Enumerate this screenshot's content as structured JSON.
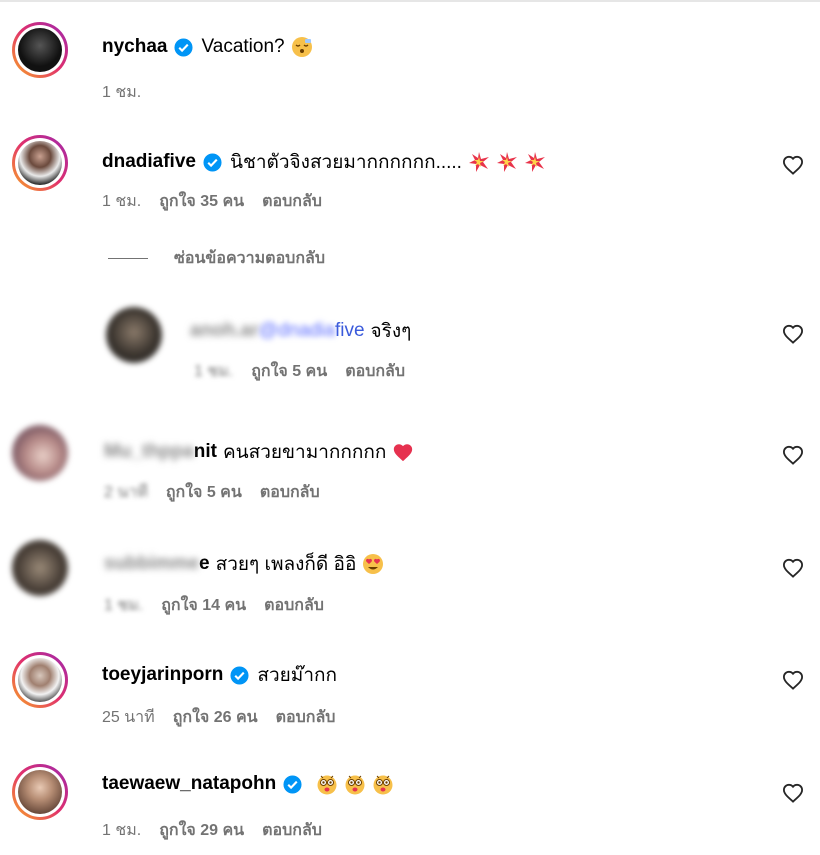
{
  "comments": [
    {
      "username": "nychaa",
      "text": "Vacation?",
      "time": "1 ชม.",
      "likes": "",
      "reply": "",
      "emoji": "sleepy-face"
    },
    {
      "username": "dnadiafive",
      "text": "นิชาตัวจิงสวยมากกกกกก.....",
      "time": "1 ชม.",
      "likes": "ถูกใจ 35 คน",
      "reply": "ตอบกลับ",
      "emoji": "collision x3"
    },
    {
      "username": "",
      "text": "จริงๆ",
      "mention_tail": "five",
      "time": "1 ชม.",
      "likes": "ถูกใจ 5 คน",
      "reply": "ตอบกลับ"
    },
    {
      "username_tail": "nit",
      "text": "คนสวยขามากกกกก",
      "time": "",
      "likes": "ถูกใจ 5 คน",
      "reply": "ตอบกลับ",
      "emoji": "heart"
    },
    {
      "username_tail": "e",
      "text": "สวยๆ เพลงก็ดี อิอิ",
      "time": "",
      "likes": "ถูกใจ 14 คน",
      "reply": "ตอบกลับ",
      "emoji": "heart-eyes"
    },
    {
      "username": "toeyjarinporn",
      "text": "สวยม๊ากก",
      "time": "25 นาที",
      "likes": "ถูกใจ 26 คน",
      "reply": "ตอบกลับ"
    },
    {
      "username": "taewaew_natapohn",
      "text": "",
      "time": "1 ชม.",
      "likes": "ถูกใจ 29 คน",
      "reply": "ตอบกลับ",
      "emoji": "astonished x3"
    }
  ],
  "hide_replies_label": "ซ่อนข้อความตอบกลับ",
  "colors": {
    "verified": "#0095f6",
    "meta_text": "#737373",
    "mention": "#3b5bdb"
  }
}
